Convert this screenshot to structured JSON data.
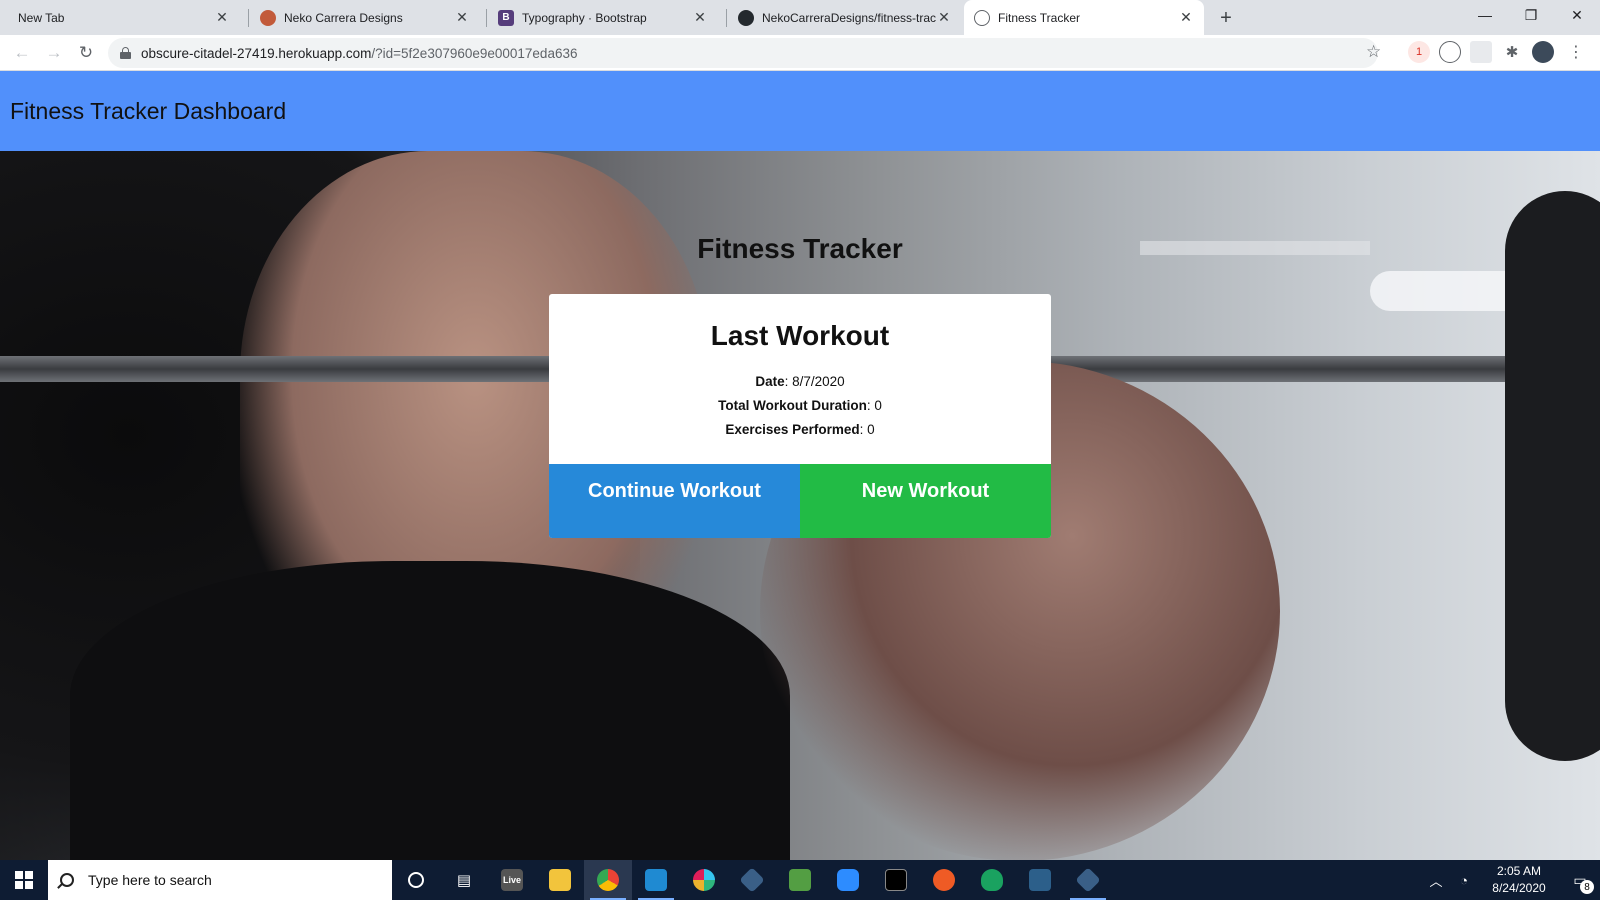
{
  "browser": {
    "tabs": [
      {
        "title": "New Tab",
        "icon": "none"
      },
      {
        "title": "Neko Carrera Designs",
        "icon": "neko-favicon"
      },
      {
        "title": "Typography · Bootstrap",
        "icon": "bootstrap-favicon"
      },
      {
        "title": "NekoCarreraDesigns/fitness-trac",
        "icon": "github-favicon"
      },
      {
        "title": "Fitness Tracker",
        "icon": "globe-favicon",
        "active": true
      }
    ],
    "url_host": "obscure-citadel-27419.herokuapp.com",
    "url_rest": "/?id=5f2e307960e9e00017eda636",
    "bootstrap_favicon_letter": "B",
    "extension_badge": "1"
  },
  "navbar": {
    "brand": "Fitness Tracker Dashboard",
    "color": "#5190fb"
  },
  "main": {
    "heading": "Fitness Tracker",
    "card": {
      "title": "Last Workout",
      "date_label": "Date",
      "date_value": ": 8/7/2020",
      "duration_label": "Total Workout Duration",
      "duration_value": ": 0",
      "exercises_label": "Exercises Performed",
      "exercises_value": ": 0"
    },
    "buttons": {
      "continue_label": "Continue Workout",
      "continue_color": "#2689d9",
      "new_label": "New Workout",
      "new_color": "#22bb45"
    }
  },
  "taskbar": {
    "search_placeholder": "Type here to search",
    "time": "2:05 AM",
    "date": "8/24/2020",
    "notification_count": "8",
    "live_label": "Live",
    "apps": [
      "cortana-icon",
      "task-view-icon",
      "live-icon",
      "file-explorer-icon",
      "chrome-icon",
      "vscode-icon",
      "slack-icon",
      "git-icon",
      "nodejs-icon",
      "zoom-icon",
      "terminal-icon",
      "postman-icon",
      "robo3t-icon",
      "mysql-workbench-icon",
      "gitkraken-icon"
    ]
  }
}
